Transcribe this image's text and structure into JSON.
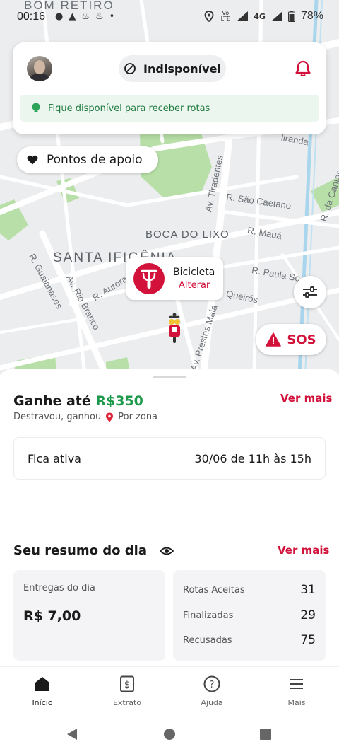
{
  "status_bar": {
    "time": "00:16",
    "battery": "78%",
    "network": "4G",
    "volte": "Vo LTE"
  },
  "map": {
    "labels": {
      "bom_retiro": "BOM RETIRO",
      "santa_ifigenia": "SANTA IFIGÊNIA",
      "boca_do_lixo": "BOCA DO LIXO",
      "sao_caetano": "R. São Caetano",
      "maua": "R. Mauá",
      "paula_souza": "R. Paula So",
      "queiros": "Queirós",
      "tiradentes": "Av. Tiradentes",
      "rio_branco": "Av. Rio Branco",
      "aurora": "R. Aurora",
      "guaianases": "R. Guaianases",
      "prestes_maia": "Av. Prestes Maia",
      "miranda": "liranda",
      "da_cantareira": "R. da Cantar",
      "paulo": "R."
    },
    "support_points_label": "Pontos de apoio",
    "vehicle": {
      "name": "Bicicleta",
      "change_label": "Alterar"
    },
    "sos_label": "SOS"
  },
  "top_card": {
    "availability_status": "Indisponível",
    "hint": "Fique disponível para receber rotas"
  },
  "earnings": {
    "title_prefix": "Ganhe até ",
    "amount": "R$350",
    "subtitle": "Destravou, ganhou",
    "zone": "Por zona",
    "see_more": "Ver mais",
    "active_label": "Fica ativa",
    "active_period": "30/06 de 11h às 15h"
  },
  "summary": {
    "title": "Seu resumo do dia",
    "see_more": "Ver mais",
    "deliveries_label": "Entregas do dia",
    "deliveries_value": "R$ 7,00",
    "stats": [
      {
        "label": "Rotas Aceitas",
        "value": "31"
      },
      {
        "label": "Finalizadas",
        "value": "29"
      },
      {
        "label": "Recusadas",
        "value": "75"
      }
    ]
  },
  "bottom_nav": [
    {
      "label": "Início",
      "icon": "home-icon",
      "active": true
    },
    {
      "label": "Extrato",
      "icon": "statement-icon",
      "active": false
    },
    {
      "label": "Ajuda",
      "icon": "help-icon",
      "active": false
    },
    {
      "label": "Mais",
      "icon": "menu-icon",
      "active": false
    }
  ],
  "colors": {
    "accent": "#d2123a",
    "green": "#1f9a4c",
    "map_bg": "#ecedef",
    "park": "#b7dfa7"
  }
}
